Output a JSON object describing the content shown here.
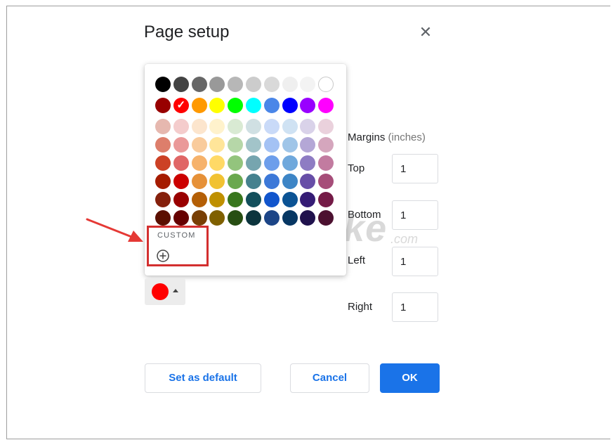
{
  "dialog": {
    "title": "Page setup",
    "close_icon": "close-icon"
  },
  "margins": {
    "label": "Margins",
    "unit": "(inches)",
    "top_label": "Top",
    "top_value": "1",
    "bottom_label": "Bottom",
    "bottom_value": "1",
    "left_label": "Left",
    "left_value": "1",
    "right_label": "Right",
    "right_value": "1"
  },
  "color_picker": {
    "custom_label": "CUSTOM",
    "add_icon": "add-circle-icon",
    "selected_color": "#ff0000",
    "rows": [
      [
        "#000000",
        "#434343",
        "#666666",
        "#999999",
        "#b7b7b7",
        "#cccccc",
        "#d9d9d9",
        "#efefef",
        "#f3f3f3",
        "#ffffff"
      ],
      [
        "#980000",
        "#ff0000",
        "#ff9900",
        "#ffff00",
        "#00ff00",
        "#00ffff",
        "#4a86e8",
        "#0000ff",
        "#9900ff",
        "#ff00ff"
      ],
      [
        "#e6b8af",
        "#f4cccc",
        "#fce5cd",
        "#fff2cc",
        "#d9ead3",
        "#d0e0e3",
        "#c9daf8",
        "#cfe2f3",
        "#d9d2e9",
        "#ead1dc"
      ],
      [
        "#dd7e6b",
        "#ea9999",
        "#f9cb9c",
        "#ffe599",
        "#b6d7a8",
        "#a2c4c9",
        "#a4c2f4",
        "#9fc5e8",
        "#b4a7d6",
        "#d5a6bd"
      ],
      [
        "#cc4125",
        "#e06666",
        "#f6b26b",
        "#ffd966",
        "#93c47d",
        "#76a5af",
        "#6d9eeb",
        "#6fa8dc",
        "#8e7cc3",
        "#c27ba0"
      ],
      [
        "#a61c00",
        "#cc0000",
        "#e69138",
        "#f1c232",
        "#6aa84f",
        "#45818e",
        "#3c78d8",
        "#3d85c6",
        "#674ea7",
        "#a64d79"
      ],
      [
        "#85200c",
        "#990000",
        "#b45f06",
        "#bf9000",
        "#38761d",
        "#134f5c",
        "#1155cc",
        "#0b5394",
        "#351c75",
        "#741b47"
      ],
      [
        "#5b0f00",
        "#660000",
        "#783f04",
        "#7f6000",
        "#274e13",
        "#0c343d",
        "#1c4587",
        "#073763",
        "#20124d",
        "#4c1130"
      ]
    ],
    "selected_row": 1,
    "selected_col": 1
  },
  "page_color_button": {
    "color": "#ff0000",
    "caret_icon": "caret-up-icon"
  },
  "buttons": {
    "set_default": "Set as default",
    "cancel": "Cancel",
    "ok": "OK"
  },
  "watermark": {
    "text": "TipsMake",
    "suffix": ".com"
  },
  "annotation": {
    "arrow_icon": "red-arrow-icon",
    "highlight_color": "#d32f2f"
  }
}
